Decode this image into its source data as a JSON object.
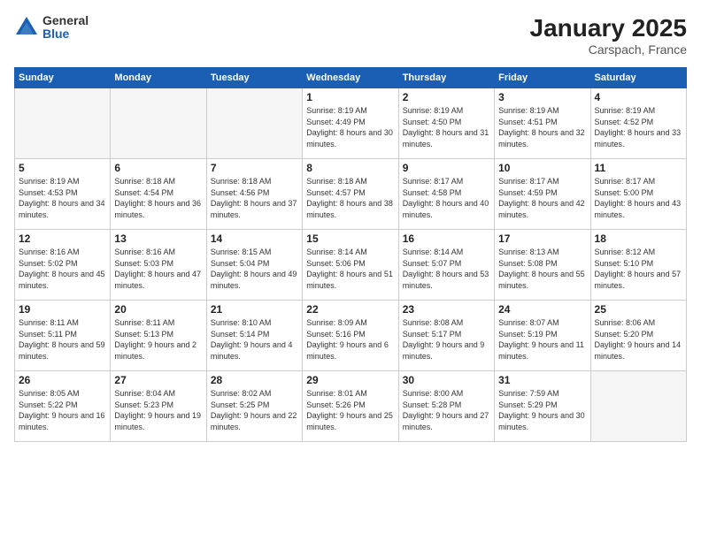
{
  "header": {
    "logo_general": "General",
    "logo_blue": "Blue",
    "month_title": "January 2025",
    "location": "Carspach, France"
  },
  "days_of_week": [
    "Sunday",
    "Monday",
    "Tuesday",
    "Wednesday",
    "Thursday",
    "Friday",
    "Saturday"
  ],
  "weeks": [
    [
      {
        "day": "",
        "empty": true
      },
      {
        "day": "",
        "empty": true
      },
      {
        "day": "",
        "empty": true
      },
      {
        "day": "1",
        "sunrise": "Sunrise: 8:19 AM",
        "sunset": "Sunset: 4:49 PM",
        "daylight": "Daylight: 8 hours and 30 minutes."
      },
      {
        "day": "2",
        "sunrise": "Sunrise: 8:19 AM",
        "sunset": "Sunset: 4:50 PM",
        "daylight": "Daylight: 8 hours and 31 minutes."
      },
      {
        "day": "3",
        "sunrise": "Sunrise: 8:19 AM",
        "sunset": "Sunset: 4:51 PM",
        "daylight": "Daylight: 8 hours and 32 minutes."
      },
      {
        "day": "4",
        "sunrise": "Sunrise: 8:19 AM",
        "sunset": "Sunset: 4:52 PM",
        "daylight": "Daylight: 8 hours and 33 minutes."
      }
    ],
    [
      {
        "day": "5",
        "sunrise": "Sunrise: 8:19 AM",
        "sunset": "Sunset: 4:53 PM",
        "daylight": "Daylight: 8 hours and 34 minutes."
      },
      {
        "day": "6",
        "sunrise": "Sunrise: 8:18 AM",
        "sunset": "Sunset: 4:54 PM",
        "daylight": "Daylight: 8 hours and 36 minutes."
      },
      {
        "day": "7",
        "sunrise": "Sunrise: 8:18 AM",
        "sunset": "Sunset: 4:56 PM",
        "daylight": "Daylight: 8 hours and 37 minutes."
      },
      {
        "day": "8",
        "sunrise": "Sunrise: 8:18 AM",
        "sunset": "Sunset: 4:57 PM",
        "daylight": "Daylight: 8 hours and 38 minutes."
      },
      {
        "day": "9",
        "sunrise": "Sunrise: 8:17 AM",
        "sunset": "Sunset: 4:58 PM",
        "daylight": "Daylight: 8 hours and 40 minutes."
      },
      {
        "day": "10",
        "sunrise": "Sunrise: 8:17 AM",
        "sunset": "Sunset: 4:59 PM",
        "daylight": "Daylight: 8 hours and 42 minutes."
      },
      {
        "day": "11",
        "sunrise": "Sunrise: 8:17 AM",
        "sunset": "Sunset: 5:00 PM",
        "daylight": "Daylight: 8 hours and 43 minutes."
      }
    ],
    [
      {
        "day": "12",
        "sunrise": "Sunrise: 8:16 AM",
        "sunset": "Sunset: 5:02 PM",
        "daylight": "Daylight: 8 hours and 45 minutes."
      },
      {
        "day": "13",
        "sunrise": "Sunrise: 8:16 AM",
        "sunset": "Sunset: 5:03 PM",
        "daylight": "Daylight: 8 hours and 47 minutes."
      },
      {
        "day": "14",
        "sunrise": "Sunrise: 8:15 AM",
        "sunset": "Sunset: 5:04 PM",
        "daylight": "Daylight: 8 hours and 49 minutes."
      },
      {
        "day": "15",
        "sunrise": "Sunrise: 8:14 AM",
        "sunset": "Sunset: 5:06 PM",
        "daylight": "Daylight: 8 hours and 51 minutes."
      },
      {
        "day": "16",
        "sunrise": "Sunrise: 8:14 AM",
        "sunset": "Sunset: 5:07 PM",
        "daylight": "Daylight: 8 hours and 53 minutes."
      },
      {
        "day": "17",
        "sunrise": "Sunrise: 8:13 AM",
        "sunset": "Sunset: 5:08 PM",
        "daylight": "Daylight: 8 hours and 55 minutes."
      },
      {
        "day": "18",
        "sunrise": "Sunrise: 8:12 AM",
        "sunset": "Sunset: 5:10 PM",
        "daylight": "Daylight: 8 hours and 57 minutes."
      }
    ],
    [
      {
        "day": "19",
        "sunrise": "Sunrise: 8:11 AM",
        "sunset": "Sunset: 5:11 PM",
        "daylight": "Daylight: 8 hours and 59 minutes."
      },
      {
        "day": "20",
        "sunrise": "Sunrise: 8:11 AM",
        "sunset": "Sunset: 5:13 PM",
        "daylight": "Daylight: 9 hours and 2 minutes."
      },
      {
        "day": "21",
        "sunrise": "Sunrise: 8:10 AM",
        "sunset": "Sunset: 5:14 PM",
        "daylight": "Daylight: 9 hours and 4 minutes."
      },
      {
        "day": "22",
        "sunrise": "Sunrise: 8:09 AM",
        "sunset": "Sunset: 5:16 PM",
        "daylight": "Daylight: 9 hours and 6 minutes."
      },
      {
        "day": "23",
        "sunrise": "Sunrise: 8:08 AM",
        "sunset": "Sunset: 5:17 PM",
        "daylight": "Daylight: 9 hours and 9 minutes."
      },
      {
        "day": "24",
        "sunrise": "Sunrise: 8:07 AM",
        "sunset": "Sunset: 5:19 PM",
        "daylight": "Daylight: 9 hours and 11 minutes."
      },
      {
        "day": "25",
        "sunrise": "Sunrise: 8:06 AM",
        "sunset": "Sunset: 5:20 PM",
        "daylight": "Daylight: 9 hours and 14 minutes."
      }
    ],
    [
      {
        "day": "26",
        "sunrise": "Sunrise: 8:05 AM",
        "sunset": "Sunset: 5:22 PM",
        "daylight": "Daylight: 9 hours and 16 minutes."
      },
      {
        "day": "27",
        "sunrise": "Sunrise: 8:04 AM",
        "sunset": "Sunset: 5:23 PM",
        "daylight": "Daylight: 9 hours and 19 minutes."
      },
      {
        "day": "28",
        "sunrise": "Sunrise: 8:02 AM",
        "sunset": "Sunset: 5:25 PM",
        "daylight": "Daylight: 9 hours and 22 minutes."
      },
      {
        "day": "29",
        "sunrise": "Sunrise: 8:01 AM",
        "sunset": "Sunset: 5:26 PM",
        "daylight": "Daylight: 9 hours and 25 minutes."
      },
      {
        "day": "30",
        "sunrise": "Sunrise: 8:00 AM",
        "sunset": "Sunset: 5:28 PM",
        "daylight": "Daylight: 9 hours and 27 minutes."
      },
      {
        "day": "31",
        "sunrise": "Sunrise: 7:59 AM",
        "sunset": "Sunset: 5:29 PM",
        "daylight": "Daylight: 9 hours and 30 minutes."
      },
      {
        "day": "",
        "empty": true
      }
    ]
  ]
}
